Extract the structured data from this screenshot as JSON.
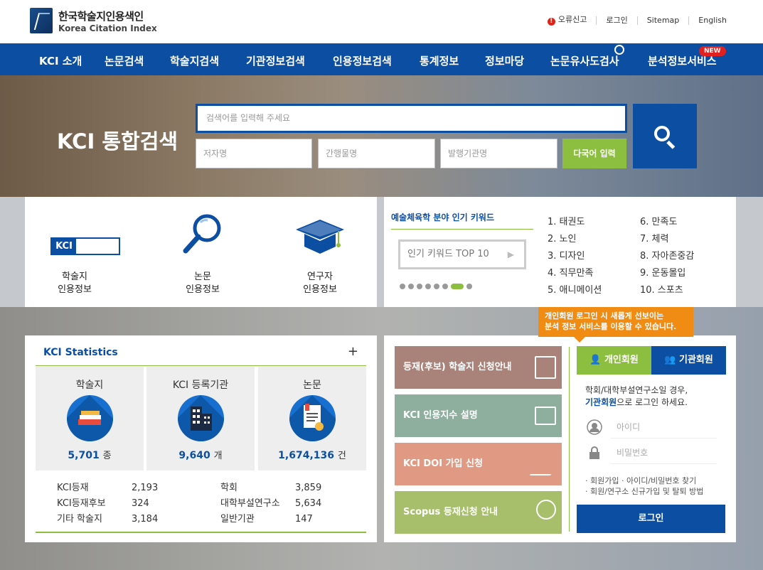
{
  "header": {
    "logo_ko": "한국학술지인용색인",
    "logo_en": "Korea Citation Index",
    "util": {
      "report": "오류신고",
      "login": "로그인",
      "sitemap": "Sitemap",
      "english": "English"
    }
  },
  "nav": {
    "items": [
      "KCI 소개",
      "논문검색",
      "학술지검색",
      "기관정보검색",
      "인용정보검색",
      "통계정보",
      "정보마당",
      "논문유사도검사",
      "분석정보서비스"
    ],
    "new_badge": "NEW"
  },
  "hero": {
    "title": "KCI 통합검색",
    "main_placeholder": "검색어를 입력해 주세요",
    "author_placeholder": "저자명",
    "journal_placeholder": "간행물명",
    "publisher_placeholder": "발행기관명",
    "multilang_label": "다국어 입력"
  },
  "quick": {
    "kci_box_text": "KCI",
    "items": [
      {
        "line1": "학술지",
        "line2": "인용정보"
      },
      {
        "line1": "논문",
        "line2": "인용정보"
      },
      {
        "line1": "연구자",
        "line2": "인용정보"
      }
    ]
  },
  "keywords": {
    "title": "예술체육학 분야 인기 키워드",
    "button": "인기 키워드 TOP 10",
    "col1": [
      "1. 태권도",
      "2. 노인",
      "3. 디자인",
      "4. 직무만족",
      "5. 애니메이션"
    ],
    "col2": [
      "6. 만족도",
      "7. 체력",
      "8. 자아존중감",
      "9. 운동몰입",
      "10. 스포츠"
    ]
  },
  "stats": {
    "title": "KCI Statistics",
    "plus": "+",
    "cards": [
      {
        "label": "학술지",
        "value": "5,701",
        "unit": "종"
      },
      {
        "label": "KCI 등록기관",
        "value": "9,640",
        "unit": "개"
      },
      {
        "label": "논문",
        "value": "1,674,136",
        "unit": "건"
      }
    ],
    "left_rows": [
      {
        "label": "KCI등재",
        "value": "2,193"
      },
      {
        "label": "KCI등재후보",
        "value": "324"
      },
      {
        "label": "기타 학술지",
        "value": "3,184"
      }
    ],
    "right_rows": [
      {
        "label": "학회",
        "value": "3,859"
      },
      {
        "label": "대학부설연구소",
        "value": "5,634"
      },
      {
        "label": "일반기관",
        "value": "147"
      }
    ]
  },
  "services": {
    "items": [
      {
        "label": "등재(후보) 학술지 신청안내",
        "color": "#a9837a"
      },
      {
        "label": "KCI 인용지수 설명",
        "color": "#8faf9e"
      },
      {
        "label": "KCI DOI 가입 신청",
        "color": "#e09a83"
      },
      {
        "label": "Scopus 등재신청 안내",
        "color": "#a7bf6b"
      }
    ]
  },
  "login": {
    "tooltip_line1": "개인회원 로그인 시 새롭게 선보이는",
    "tooltip_line2": "분석 정보 서비스를 이용할 수 있습니다.",
    "tab_personal": "개인회원",
    "tab_org": "기관회원",
    "desc_line1": "학회/대학부설연구소일 경우,",
    "desc_line2_bold": "기관회원",
    "desc_line2_rest": "으로 로그인 하세요.",
    "id_placeholder": "아이디",
    "pw_placeholder": "비밀번호",
    "link1": "· 회원가입   · 아이디/비밀번호 찾기",
    "link2": "· 회원/연구소 신규가입 및 탈퇴 방법",
    "button": "로그인"
  }
}
